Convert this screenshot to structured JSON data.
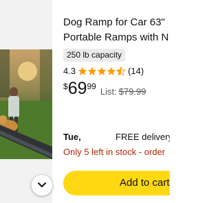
{
  "product": {
    "title_line1": "Dog Ramp for Car 63\"",
    "title_line2": "Portable Ramps with N",
    "capacity_badge": "250 lb capacity",
    "rating": {
      "value": "4.3",
      "stars": 4.3,
      "count": "(14)"
    },
    "price": {
      "symbol": "$",
      "whole": "69",
      "fraction": "99",
      "list_label": "List:",
      "list_price": "$79.99"
    },
    "delivery": {
      "day": "Tue,",
      "free_text": "FREE delivery"
    },
    "stock_text": "Only 5 left in stock - order",
    "add_to_cart_label": "Add to cart"
  },
  "colors": {
    "star": "#ff9900",
    "cart_button": "#ffd814",
    "stock_warning": "#b12704",
    "badge_bg": "#ebebeb",
    "muted_text": "#565959"
  },
  "icons": {
    "toggle": "chevron-down-icon",
    "rating": "star-icon"
  }
}
